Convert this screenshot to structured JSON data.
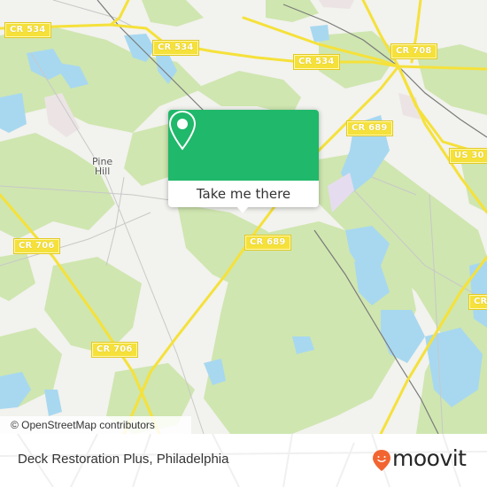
{
  "map": {
    "attribution": "© OpenStreetMap contributors",
    "place_labels": [
      {
        "name": "Pine Hill",
        "line1": "Pine",
        "line2": "Hill"
      }
    ],
    "road_shields": [
      {
        "label": "CR 534"
      },
      {
        "label": "CR 534"
      },
      {
        "label": "CR 534"
      },
      {
        "label": "CR 708"
      },
      {
        "label": "CR 689"
      },
      {
        "label": "US 30"
      },
      {
        "label": "CR 706"
      },
      {
        "label": "CR 689"
      },
      {
        "label": "CR 706"
      },
      {
        "label": "CR"
      }
    ],
    "colors": {
      "background": "#f2f2ee",
      "forest": "#cfe6b0",
      "water": "#a8d8f0",
      "road": "#f5e13a",
      "rail": "#7a7a7a"
    }
  },
  "popup": {
    "icon": "map-pin-icon",
    "button_label": "Take me there",
    "color": "#20b86a"
  },
  "footer": {
    "title": "Deck Restoration Plus, Philadelphia",
    "logo_text": "moovit",
    "logo_icon": "moovit-pin-icon",
    "logo_color": "#f26531"
  }
}
